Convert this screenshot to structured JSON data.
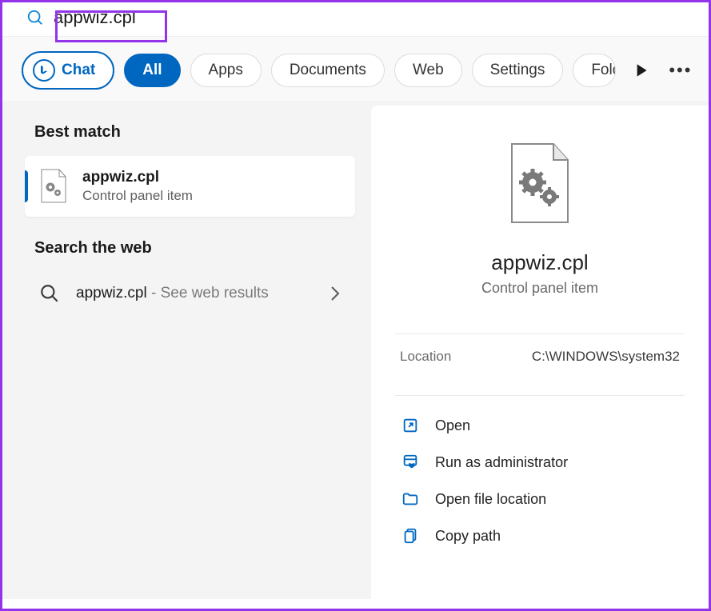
{
  "search": {
    "value": "appwiz.cpl"
  },
  "filters": {
    "chat": "Chat",
    "all": "All",
    "apps": "Apps",
    "documents": "Documents",
    "web": "Web",
    "settings": "Settings",
    "folders": "Folders"
  },
  "left": {
    "bestMatchHeader": "Best match",
    "result": {
      "title": "appwiz.cpl",
      "subtitle": "Control panel item"
    },
    "searchWebHeader": "Search the web",
    "webItem": {
      "primary": "appwiz.cpl",
      "secondary": " - See web results"
    }
  },
  "detail": {
    "title": "appwiz.cpl",
    "subtitle": "Control panel item",
    "meta": {
      "locationLabel": "Location",
      "locationValue": "C:\\WINDOWS\\system32"
    },
    "actions": [
      {
        "icon": "open",
        "label": "Open"
      },
      {
        "icon": "admin",
        "label": "Run as administrator"
      },
      {
        "icon": "folder",
        "label": "Open file location"
      },
      {
        "icon": "copy",
        "label": "Copy path"
      }
    ]
  }
}
